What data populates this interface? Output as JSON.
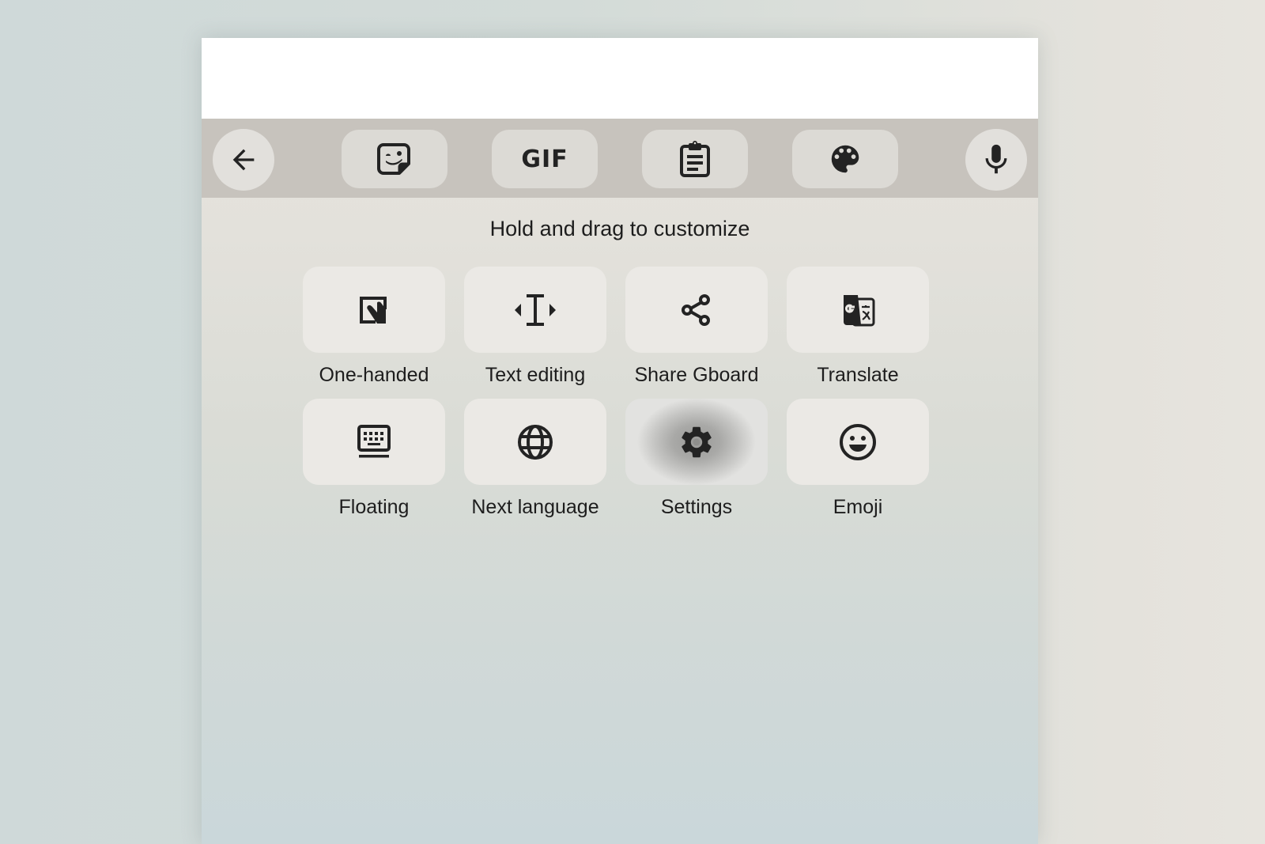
{
  "text_field": {
    "value": ""
  },
  "toolbar": {
    "back": {
      "icon": "arrow-left-icon",
      "label": "Back"
    },
    "items": [
      {
        "id": "stickers",
        "icon": "sticker-icon"
      },
      {
        "id": "gif",
        "label": "GIF"
      },
      {
        "id": "clipboard",
        "icon": "clipboard-icon"
      },
      {
        "id": "themes",
        "icon": "palette-icon"
      }
    ],
    "voice": {
      "icon": "microphone-icon",
      "label": "Voice typing"
    }
  },
  "panel": {
    "hint": "Hold and drag to customize",
    "tiles": [
      {
        "label": "One-handed",
        "icon": "one-handed-icon"
      },
      {
        "label": "Text editing",
        "icon": "text-cursor-icon"
      },
      {
        "label": "Share Gboard",
        "icon": "share-icon"
      },
      {
        "label": "Translate",
        "icon": "translate-icon"
      },
      {
        "label": "Floating",
        "icon": "floating-keyboard-icon"
      },
      {
        "label": "Next language",
        "icon": "globe-icon"
      },
      {
        "label": "Settings",
        "icon": "gear-icon",
        "pressed": true
      },
      {
        "label": "Emoji",
        "icon": "emoji-icon"
      }
    ]
  },
  "colors": {
    "toolbar_bg": "#c7c3bd",
    "button_bg": "#dcdad5",
    "tile_bg": "#ebe9e5",
    "icon": "#232323"
  }
}
